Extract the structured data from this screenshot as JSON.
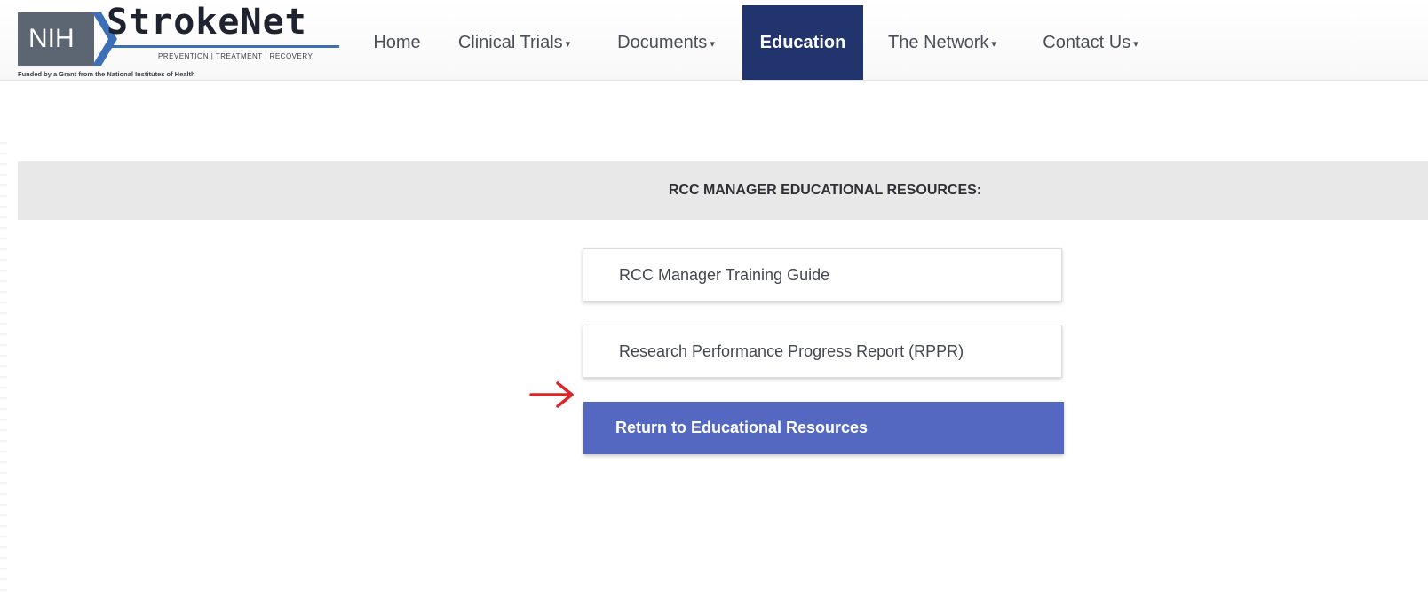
{
  "logo": {
    "nih": "NIH",
    "title": "StrokeNet",
    "tagline": "PREVENTION  |  TREATMENT  |  RECOVERY",
    "funded": "Funded by a Grant from the National Institutes of Health"
  },
  "nav": {
    "home": "Home",
    "clinical_trials": "Clinical Trials",
    "documents": "Documents",
    "education": "Education",
    "network": "The Network",
    "contact": "Contact Us",
    "caret": "▾"
  },
  "section": {
    "title": "RCC MANAGER EDUCATIONAL RESOURCES:"
  },
  "resources": {
    "training_guide": "RCC Manager Training Guide",
    "rppr": "Research Performance Progress Report (RPPR)",
    "return": "Return to Educational Resources"
  },
  "colors": {
    "nav_active": "#22346e",
    "return_button": "#5468c2",
    "arrow": "#d8262a",
    "section_bar": "#e8e8e8"
  },
  "icons": {
    "annotation_arrow": "red-right-arrow-icon"
  }
}
